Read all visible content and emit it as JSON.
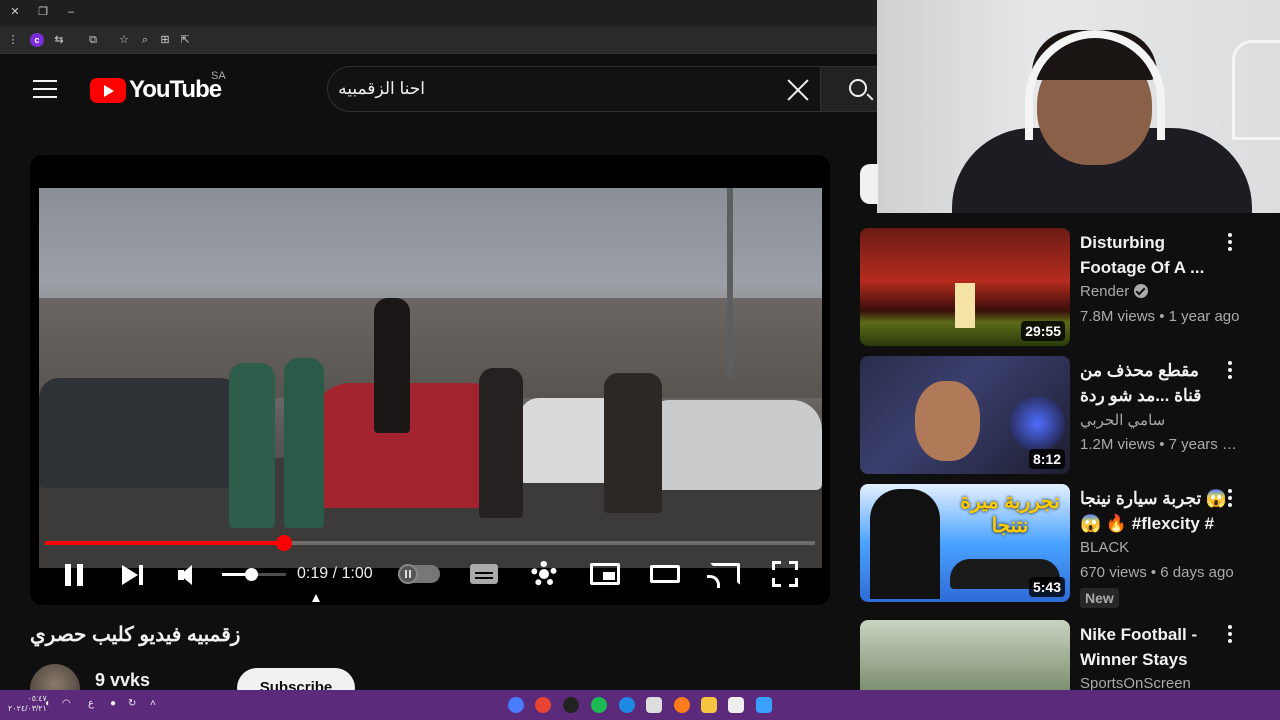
{
  "header": {
    "logo_text": "YouTube",
    "country_code": "SA",
    "search_value": "احنا الزقمبيه"
  },
  "player": {
    "current_time": "0:19",
    "duration": "1:00",
    "time_display": "0:19 / 1:00",
    "progress_fraction": 0.31,
    "volume_fraction": 0.45
  },
  "video": {
    "title": "زقمبيه فيديو كليب حصري",
    "channel_name": "9 vvks",
    "subscribe_label": "Subscribe"
  },
  "recommendations": [
    {
      "title": "Disturbing Footage Of A ...",
      "channel": "Render",
      "verified": true,
      "views": "7.8M views",
      "age": "1 year ago",
      "meta": "7.8M views • 1 year ago",
      "duration": "29:55"
    },
    {
      "title": "مقطع محذف من قناة ...مد شو ردة فعله على",
      "channel": "سامي الحربي",
      "views": "1.2M views",
      "age": "7 years a...",
      "meta": "1.2M views • 7 years a...",
      "duration": "8:12"
    },
    {
      "title": "😱 تجربة سيارة نينجا # flexcity# 🔥 😱",
      "channel": "BLACK",
      "views": "670 views",
      "age": "6 days ago",
      "meta": "670 views • 6 days ago",
      "badge": "New",
      "duration": "5:43",
      "thumb_text": "نجرربة ميرة نتنجا"
    },
    {
      "title": "Nike Football - Winner Stays",
      "channel": "SportsOnScreen"
    }
  ],
  "taskbar": {
    "clock": "٠٥:٤٧",
    "date": "٢٠٢٤/٠٣/٢١",
    "lang": "ع"
  },
  "colors": {
    "accent_red": "#ff0000",
    "background": "#0f0f0f",
    "taskbar": "#5b2a7a"
  }
}
